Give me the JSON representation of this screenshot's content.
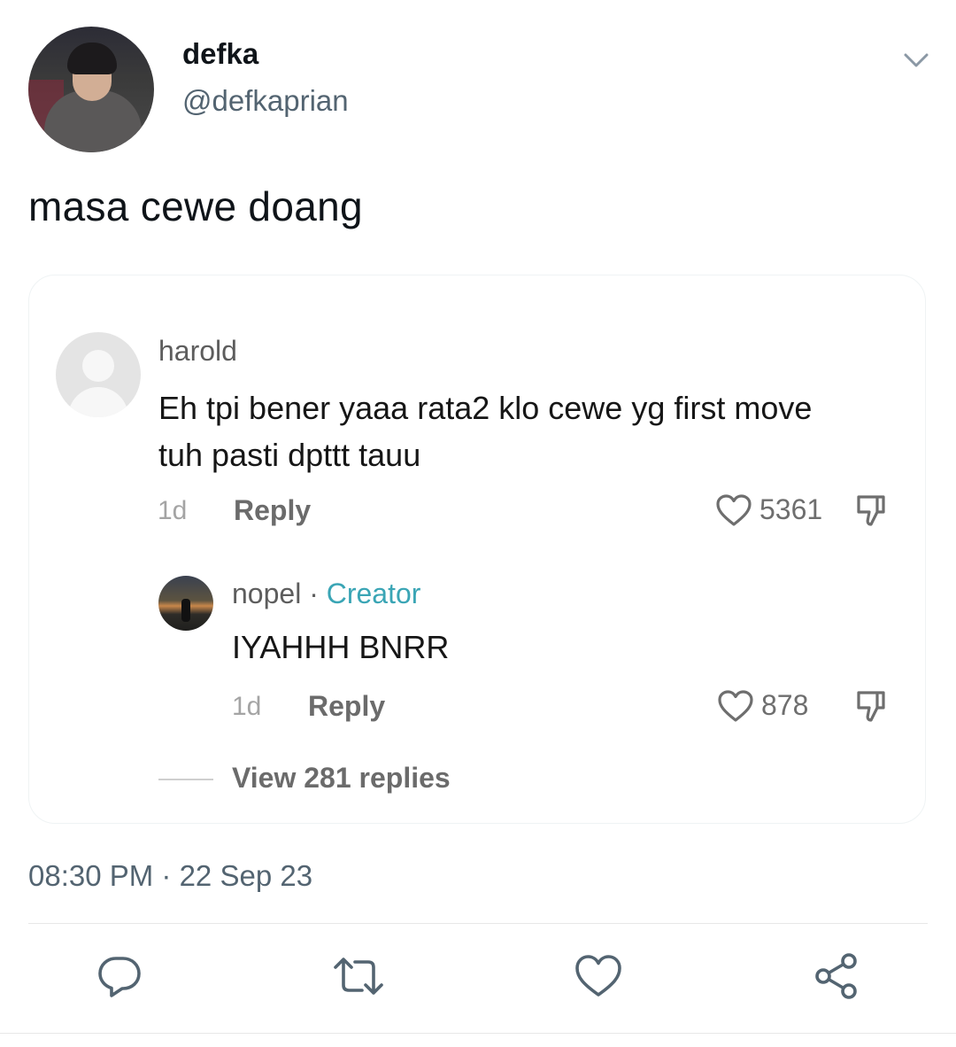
{
  "tweet": {
    "author": {
      "display_name": "defka",
      "handle": "@defkaprian"
    },
    "text": "masa cewe doang",
    "timestamp": "08:30 PM · 22 Sep 23"
  },
  "embedded_comment": {
    "comment": {
      "username": "harold",
      "text": "Eh tpi bener yaaa rata2 klo cewe yg first move tuh pasti dpttt tauu",
      "age": "1d",
      "reply_label": "Reply",
      "likes": "5361"
    },
    "reply": {
      "username": "nopel",
      "separator": " · ",
      "badge": "Creator",
      "text": "IYAHHH BNRR",
      "age": "1d",
      "reply_label": "Reply",
      "likes": "878"
    },
    "view_replies_label": "View 281 replies"
  },
  "actions": [
    "reply-icon",
    "retweet-icon",
    "like-icon",
    "share-icon"
  ],
  "colors": {
    "secondary_text": "#536471",
    "creator_badge": "#3aa5b5",
    "icon": "#536471"
  }
}
